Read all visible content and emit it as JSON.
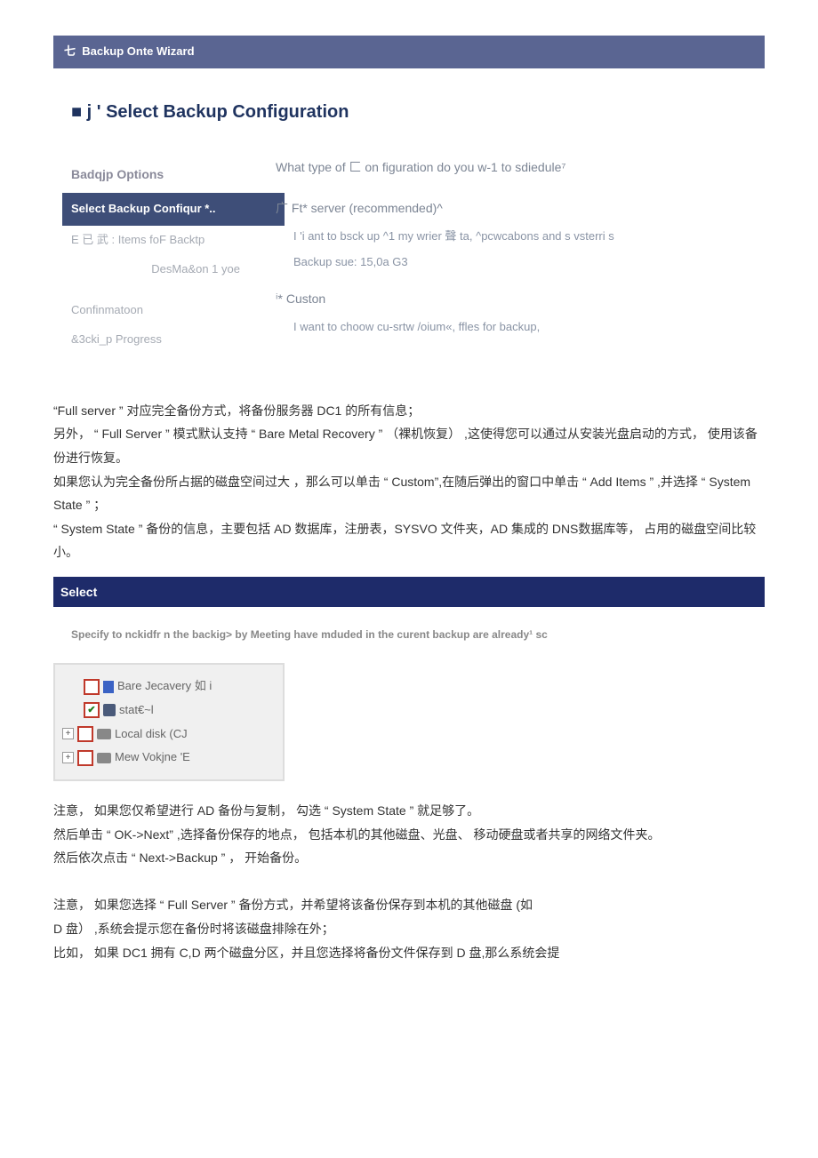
{
  "wizard": {
    "titlebar": "七 ­ Backup Onte Wizard",
    "heading": "■ j ' Select Backup Configuration",
    "steps": {
      "s1": "Badqjp Options",
      "s2_selected": "Select Backup Conﬁqur *..",
      "s3": "E 已 武 : Items foF Backtp",
      "s4": "DesMa&on 1 yoe",
      "s5": "Confinmatoon",
      "s6": "&3cki_p Progress"
    },
    "question": "What type of 匚 on figuration do you w-1 to sdiedule⁷",
    "opt1": {
      "label": "广 Ft* server (recommended)^",
      "desc_l1": "I 'i ant to bsck up ^1 my wrier 聲 ta, ^pcwcabons and s vsterri s",
      "desc_l2": "Backup sue: 15,0a G3"
    },
    "opt2": {
      "label": "ⁱ* Custon",
      "desc": "I want to choow cu-srtw /oium«, ffles for backup,"
    }
  },
  "prose": {
    "p1": "“Full server ” 对应完全备份方式，将备份服务器          DC1 的所有信息；",
    "p2": "另外， “ Full Server ” 模式默认支持 “  Bare Metal Recovery ” （裸机恢复） ,这使得您可以通过从安装光盘启动的方式， 使用该备份进行恢复。",
    "p3": "如果您认为完全备份所占据的磁盘空间过大      ，那么可以单击 “ Custom”,在随后弹出的窗口中单击 “ Add Items ”  ,并选择 “ System State ” ；",
    "p4": "  “ System State ” 备份的信息，主要包括 AD 数据库，注册表，SYSVO 文件夹，AD 集成的  DNS数据库等， 占用的磁盘空间比较小。"
  },
  "section_bar": "Select",
  "subtext": "Specify to nckidfr n the backig> by Meeting have mduded in the curent backup are already¹ sc",
  "tree": {
    "i1": "Bare Jecavery 如 i",
    "i2": "stat€~l",
    "i3": "Local disk (CJ",
    "i4": "Mew Vokjne 'E"
  },
  "prose2": {
    "p5": "注意， 如果您仅希望进行  AD 备份与复制， 勾选 “ System State ” 就足够了。",
    "p6": "然后单击 “ OK->Next”  ,选择备份保存的地点， 包括本机的其他磁盘、光盘、      移动硬盘或者共享的网络文件夹。",
    "p7": "然后依次点击 “ Next->Backup ” ， 开始备份。",
    "p8": "注意， 如果您选择 “ Full Server ” 备份方式，并希望将该备份保存到本机的其他磁盘         (如",
    "p9": "D 盘） ,系统会提示您在备份时将该磁盘排除在外；",
    "p10": "比如， 如果 DC1 拥有 C,D 两个磁盘分区，并且您选择将备份文件保存到      D 盘,那么系统会提"
  }
}
